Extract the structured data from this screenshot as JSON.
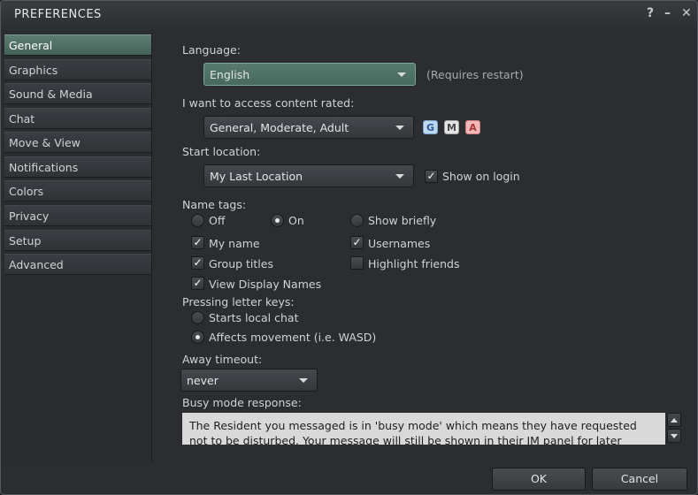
{
  "window": {
    "title": "PREFERENCES",
    "help_glyph": "?",
    "minimize_glyph": "–",
    "close_glyph": "✕"
  },
  "sidebar": {
    "items": [
      {
        "label": "General"
      },
      {
        "label": "Graphics"
      },
      {
        "label": "Sound & Media"
      },
      {
        "label": "Chat"
      },
      {
        "label": "Move & View"
      },
      {
        "label": "Notifications"
      },
      {
        "label": "Colors"
      },
      {
        "label": "Privacy"
      },
      {
        "label": "Setup"
      },
      {
        "label": "Advanced"
      }
    ]
  },
  "general": {
    "language_label": "Language:",
    "language_value": "English",
    "language_note": "(Requires restart)",
    "content_label": "I want to access content rated:",
    "content_value": "General, Moderate, Adult",
    "ratings": [
      "G",
      "M",
      "A"
    ],
    "start_label": "Start location:",
    "start_value": "My Last Location",
    "show_on_login": "Show on login",
    "name_tags_label": "Name tags:",
    "name_tag_options": [
      "Off",
      "On",
      "Show briefly"
    ],
    "my_name": "My name",
    "usernames": "Usernames",
    "group_titles": "Group titles",
    "highlight_friends": "Highlight friends",
    "view_display_names": "View Display Names",
    "letter_keys_label": "Pressing letter keys:",
    "letter_key_options": [
      "Starts local chat",
      "Affects movement (i.e. WASD)"
    ],
    "away_label": "Away timeout:",
    "away_value": "never",
    "busy_label": "Busy mode response:",
    "busy_text": "The Resident you messaged is in 'busy mode' which means they have requested not to be disturbed.  Your message will still be shown in their IM panel for later viewing."
  },
  "footer": {
    "ok": "OK",
    "cancel": "Cancel"
  },
  "colors": {
    "accent": "#5c7d72",
    "rating_g": "#bcd8f0",
    "rating_m": "#e4e4e4",
    "rating_a": "#f2b8b8"
  }
}
